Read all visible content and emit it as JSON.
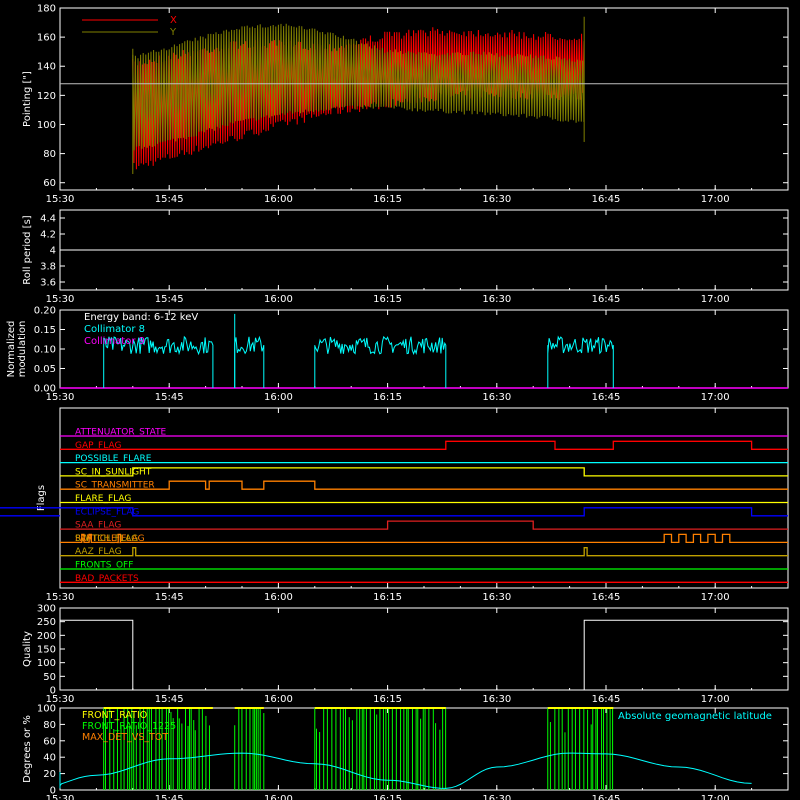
{
  "colors": {
    "background": "#000000",
    "axes": "#ffffff",
    "red": "#ff0000",
    "olive": "#808000",
    "cyan": "#00ffff",
    "magenta": "#ff00ff",
    "orange": "#ff8000",
    "yellow": "#ffff00",
    "blue": "#0000ff",
    "green": "#00ff00",
    "olive_flag": "#c0a000",
    "dark_red": "#e02020"
  },
  "chart_data": [
    {
      "id": "pointing",
      "type": "line",
      "ylabel": "Pointing [\"]",
      "ylim": [
        55,
        180
      ],
      "yticks": [
        60,
        80,
        100,
        120,
        140,
        160,
        180
      ],
      "reference_line": 128,
      "legend": [
        {
          "name": "X",
          "color": "#ff0000"
        },
        {
          "name": "Y",
          "color": "#808000"
        }
      ],
      "series": [
        {
          "name": "X",
          "color": "#ff0000",
          "x_min": [
            15.677,
            15.75,
            15.85,
            15.95,
            16.05,
            16.15,
            16.3,
            16.45,
            16.55,
            16.7
          ],
          "lower": [
            68,
            78,
            88,
            98,
            106,
            111,
            116,
            118,
            117,
            116
          ],
          "upper": [
            145,
            152,
            158,
            158,
            156,
            164,
            167,
            166,
            164,
            163
          ]
        },
        {
          "name": "Y",
          "color": "#808000",
          "x_min": [
            15.677,
            15.75,
            15.85,
            15.95,
            16.05,
            16.15,
            16.3,
            16.45,
            16.55,
            16.7
          ],
          "lower": [
            82,
            90,
            100,
            106,
            110,
            110,
            108,
            106,
            104,
            100
          ],
          "upper": [
            148,
            158,
            168,
            170,
            163,
            152,
            150,
            150,
            148,
            145
          ]
        }
      ],
      "span": [
        "15:40",
        "16:42"
      ]
    },
    {
      "id": "roll",
      "type": "line",
      "ylabel": "Roll period [s]",
      "ylim": [
        3.5,
        4.5
      ],
      "yticks": [
        3.6,
        3.8,
        4.0,
        4.2,
        4.4
      ],
      "series": [
        {
          "name": "",
          "values": [
            4.0
          ]
        }
      ]
    },
    {
      "id": "modulation",
      "type": "line",
      "ylabel": [
        "Normalized",
        "modulation"
      ],
      "ylim": [
        0,
        0.2
      ],
      "yticks": [
        "0.00",
        "0.05",
        "0.10",
        "0.15",
        "0.20"
      ],
      "legend": [
        {
          "name": "Energy band: 6-12 keV",
          "color": "#ffffff"
        },
        {
          "name": "Collimator 8",
          "color": "#00ffff"
        },
        {
          "name": "Collimator 9",
          "color": "#ff00ff"
        }
      ],
      "segments": [
        {
          "start": "15:36",
          "end": "15:51",
          "level": 0.11
        },
        {
          "start": "15:54",
          "end": "15:58",
          "level": 0.11
        },
        {
          "start": "16:05",
          "end": "16:23",
          "level": 0.11
        },
        {
          "start": "16:37",
          "end": "16:46",
          "level": 0.11
        }
      ],
      "baseline_series": {
        "name": "Collimator 9",
        "value": 0.0
      }
    },
    {
      "id": "flags",
      "type": "table",
      "ylabel": "Flags",
      "rows": [
        {
          "name": "ATTENUATOR_STATE",
          "color": "#ff00ff",
          "high": []
        },
        {
          "name": "GAP_FLAG",
          "color": "#ff0000",
          "high": [
            [
              "16:23",
              "16:38"
            ],
            [
              "16:46",
              "17:05"
            ]
          ]
        },
        {
          "name": "POSSIBLE_FLARE",
          "color": "#00ffff",
          "high": []
        },
        {
          "name": "SC_IN_SUNLIGHT",
          "color": "#ffff00",
          "high": [
            [
              "15:40",
              "16:42"
            ]
          ]
        },
        {
          "name": "SC_TRANSMITTER",
          "color": "#ff8000",
          "high": [
            [
              "15:45",
              "15:50"
            ],
            [
              "15:50.5",
              "15:55"
            ],
            [
              "15:58",
              "16:05"
            ]
          ]
        },
        {
          "name": "FLARE_FLAG",
          "color": "#ffff00",
          "high": []
        },
        {
          "name": "ECLIPSE_FLAG",
          "color": "#0000ff",
          "high": [
            [
              "15:20",
              "15:40"
            ],
            [
              "16:42",
              "17:05"
            ]
          ]
        },
        {
          "name": "SAA_FLAG",
          "color": "#e02020",
          "high": [
            [
              "16:15",
              "16:35"
            ]
          ]
        },
        {
          "name": "PARTICLE_FLAG",
          "overlay": "SWITCH_FLAG",
          "color": "#ff8000",
          "high": [
            [
              "15:33",
              "15:33.3"
            ],
            [
              "15:34",
              "15:34.3"
            ],
            [
              "15:38",
              "15:38.3"
            ],
            [
              "16:53",
              "16:54"
            ],
            [
              "16:55",
              "16:56"
            ],
            [
              "16:57",
              "16:58"
            ],
            [
              "16:59",
              "17:00"
            ],
            [
              "17:01",
              "17:02"
            ]
          ]
        },
        {
          "name": "AAZ_FLAG",
          "color": "#c0a000",
          "high": [
            [
              "15:40",
              "15:40.4"
            ],
            [
              "16:42",
              "16:42.4"
            ]
          ]
        },
        {
          "name": "FRONTS_OFF",
          "color": "#00ff00",
          "high": []
        },
        {
          "name": "BAD_PACKETS",
          "color": "#ff0000",
          "high": []
        }
      ]
    },
    {
      "id": "quality",
      "type": "line",
      "ylabel": "Quality",
      "ylim": [
        0,
        300
      ],
      "yticks": [
        0,
        50,
        100,
        150,
        200,
        250,
        300
      ],
      "series": [
        {
          "name": "",
          "x": [
            "15:20",
            "15:40",
            "15:40",
            "16:42",
            "16:42",
            "17:05"
          ],
          "y": [
            255,
            255,
            0,
            0,
            255,
            255
          ]
        }
      ]
    },
    {
      "id": "ratios",
      "type": "line",
      "ylabel": "Degrees or %",
      "ylim": [
        0,
        100
      ],
      "yticks": [
        0,
        20,
        40,
        60,
        80,
        100
      ],
      "legend": [
        {
          "name": "FRONT_RATIO",
          "color": "#ffff00"
        },
        {
          "name": "FRONT_RATIO_1225",
          "color": "#00ff00"
        },
        {
          "name": "MAX_DET_VS_TOT",
          "color": "#ff8000"
        }
      ],
      "right_label": {
        "text": "Absolute geomagnetic latitude",
        "color": "#00ffff"
      },
      "latitude": {
        "x": [
          "15:20",
          "15:27",
          "15:35",
          "15:45",
          "15:55",
          "16:05",
          "16:15",
          "16:23",
          "16:30",
          "16:40",
          "16:45",
          "16:55",
          "17:05"
        ],
        "y": [
          22,
          2,
          18,
          38,
          45,
          32,
          12,
          2,
          28,
          45,
          44,
          28,
          8
        ]
      },
      "green_bands": [
        [
          "15:36",
          "15:51"
        ],
        [
          "15:54",
          "15:58"
        ],
        [
          "16:05",
          "16:23"
        ],
        [
          "16:37",
          "16:46"
        ]
      ]
    }
  ],
  "x_axis": {
    "tick_labels": [
      "15:30",
      "15:45",
      "16:00",
      "16:15",
      "16:30",
      "16:45",
      "17:00"
    ],
    "range_minutes": [
      930,
      1030
    ]
  }
}
